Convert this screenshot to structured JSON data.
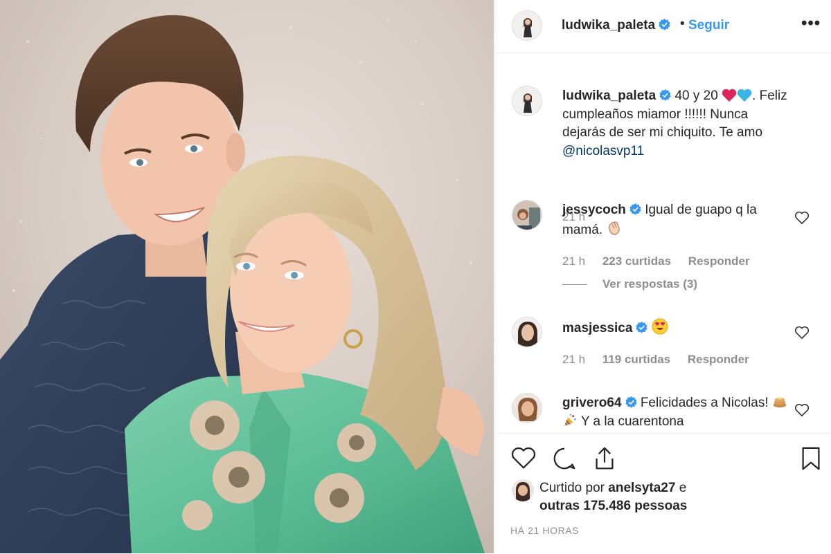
{
  "post": {
    "username": "ludwika_paleta",
    "follow_label": "Seguir",
    "separator": "•",
    "more_label": "•••",
    "caption_pre": "40 y 20",
    "caption_post": ". Feliz cumpleaños miamor !!!!!! Nunca dejarás de ser mi chiquito. Te amo",
    "caption_mention": "@nicolasvp11",
    "caption_time": "21 h"
  },
  "comments": [
    {
      "username": "jessycoch",
      "text": "Igual de guapo q la mamá.",
      "emoji": "clap",
      "time": "21 h",
      "likes": "223 curtidas",
      "reply_label": "Responder",
      "view_replies": "Ver respostas (3)"
    },
    {
      "username": "masjessica",
      "text": "",
      "emoji": "heart-eyes",
      "time": "21 h",
      "likes": "119 curtidas",
      "reply_label": "Responder"
    },
    {
      "username": "grivero64",
      "text_pre": "Felicidades a Nicolas!",
      "text_post": "Y a la cuarentona"
    }
  ],
  "liked_by": {
    "prefix": "Curtido por",
    "user": "anelsyta27",
    "conj": "e",
    "others": "outras 175.486 pessoas"
  },
  "time_ago": "HÁ 21 HORAS",
  "icons": [
    "heart-icon",
    "comment-icon",
    "share-icon",
    "bookmark-icon",
    "verified-badge-icon",
    "more-options-icon"
  ],
  "colors": {
    "link_blue": "#3897f0",
    "mention_blue": "#003569",
    "verified_blue": "#3897f0",
    "muted_gray": "#8e8e8e",
    "text": "#262626",
    "heart_red": "#e0245e",
    "heart_blue": "#3ab5e6"
  }
}
